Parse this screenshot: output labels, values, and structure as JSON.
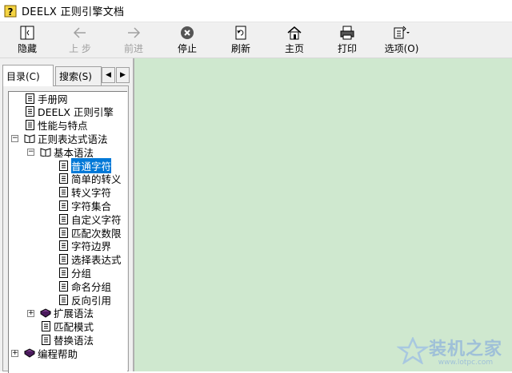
{
  "window": {
    "title": "DEELX 正则引擎文档",
    "icon": "help-file-icon"
  },
  "toolbar": {
    "buttons": [
      {
        "label": "隐藏",
        "icon": "hide-pane-icon",
        "enabled": true
      },
      {
        "label": "上 步",
        "icon": "back-arrow-icon",
        "enabled": false
      },
      {
        "label": "前进",
        "icon": "forward-arrow-icon",
        "enabled": false
      },
      {
        "label": "停止",
        "icon": "stop-icon",
        "enabled": true
      },
      {
        "label": "刷新",
        "icon": "refresh-icon",
        "enabled": true
      },
      {
        "label": "主页",
        "icon": "home-icon",
        "enabled": true
      },
      {
        "label": "打印",
        "icon": "printer-icon",
        "enabled": true
      },
      {
        "label": "选项(O)",
        "icon": "options-icon",
        "enabled": true
      }
    ]
  },
  "tabs": [
    {
      "label": "目录(C)",
      "active": true
    },
    {
      "label": "搜索(S)",
      "active": false
    }
  ],
  "tree": [
    {
      "label": "手册网",
      "type": "page"
    },
    {
      "label": "DEELX 正则引擎",
      "type": "page"
    },
    {
      "label": "性能与特点",
      "type": "page"
    },
    {
      "label": "正则表达式语法",
      "type": "book-open",
      "expander": "−"
    },
    {
      "label": "基本语法",
      "type": "book-open",
      "expander": "−"
    },
    {
      "label": "普通字符",
      "type": "page",
      "selected": true
    },
    {
      "label": "简单的转义",
      "type": "page"
    },
    {
      "label": "转义字符",
      "type": "page"
    },
    {
      "label": "字符集合",
      "type": "page"
    },
    {
      "label": "自定义字符",
      "type": "page"
    },
    {
      "label": "匹配次数限",
      "type": "page"
    },
    {
      "label": "字符边界",
      "type": "page"
    },
    {
      "label": "选择表达式",
      "type": "page"
    },
    {
      "label": "分组",
      "type": "page"
    },
    {
      "label": "命名分组",
      "type": "page"
    },
    {
      "label": "反向引用",
      "type": "page"
    },
    {
      "label": "扩展语法",
      "type": "book-closed",
      "expander": "+"
    },
    {
      "label": "匹配模式",
      "type": "page"
    },
    {
      "label": "替换语法",
      "type": "page"
    },
    {
      "label": "编程帮助",
      "type": "book-closed",
      "expander": "+"
    }
  ],
  "watermark": {
    "text": "装机之家",
    "url": "www.lotpc.com"
  },
  "colors": {
    "content_bg": "#cfe8cf",
    "selection": "#0078d7",
    "book_purple": "#7a3a8c"
  }
}
